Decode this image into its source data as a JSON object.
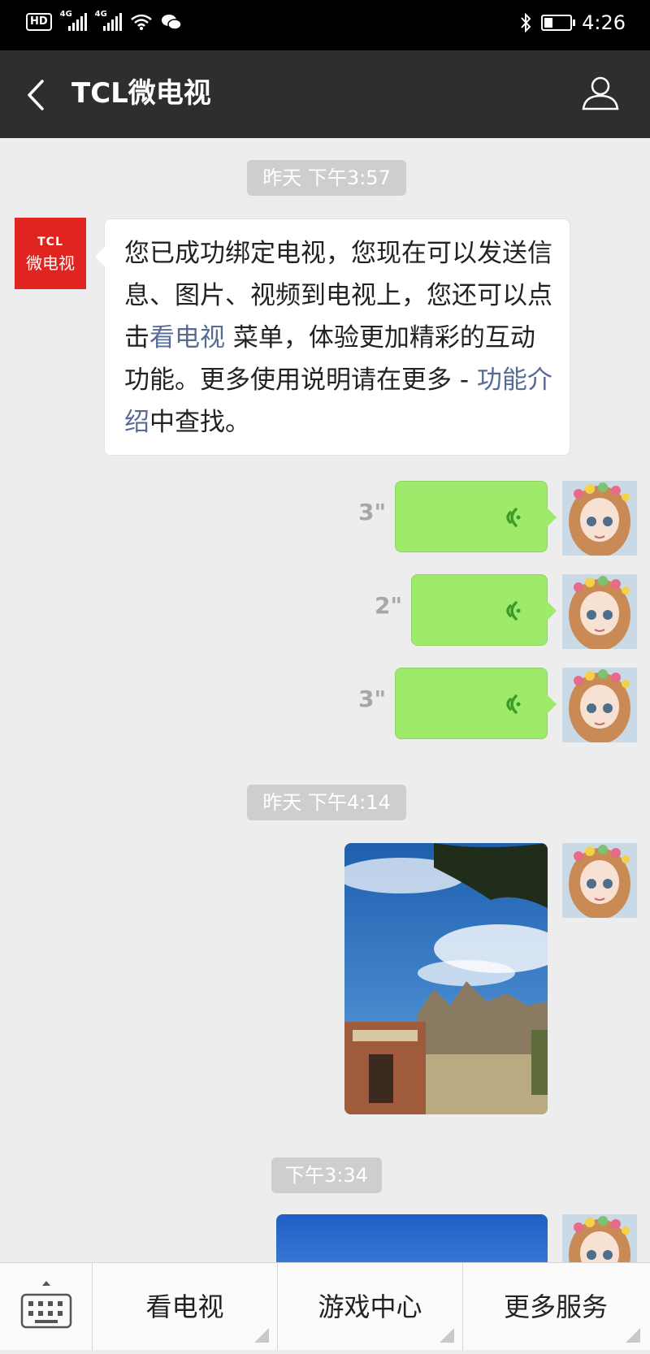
{
  "status": {
    "hd": "HD",
    "net1": "4G",
    "net2": "4G",
    "time": "4:26"
  },
  "header": {
    "title": "TCL微电视"
  },
  "chat": {
    "bot_avatar": {
      "line1": "TCL",
      "line2": "微电视"
    },
    "time1": "昨天 下午3:57",
    "welcome": {
      "part1": "您已成功绑定电视，您现在可以发送信息、图片、视频到电视上，您还可以点击",
      "link1": "看电视",
      "part2": " 菜单，体验更加精彩的互动功能。更多使用说明请在更多 - ",
      "link2": "功能介绍",
      "part3": "中查找。"
    },
    "voice_messages": [
      {
        "duration": "3\""
      },
      {
        "duration": "2\""
      },
      {
        "duration": "3\""
      }
    ],
    "time2": "昨天 下午4:14",
    "time3": "下午3:34"
  },
  "menu": {
    "items": [
      "看电视",
      "游戏中心",
      "更多服务"
    ]
  },
  "colors": {
    "title_bar": "#2e2e2e",
    "chat_bg": "#ededed",
    "voice_bubble": "#9eea6a",
    "link": "#576b95",
    "tcl_red": "#e0241f"
  }
}
